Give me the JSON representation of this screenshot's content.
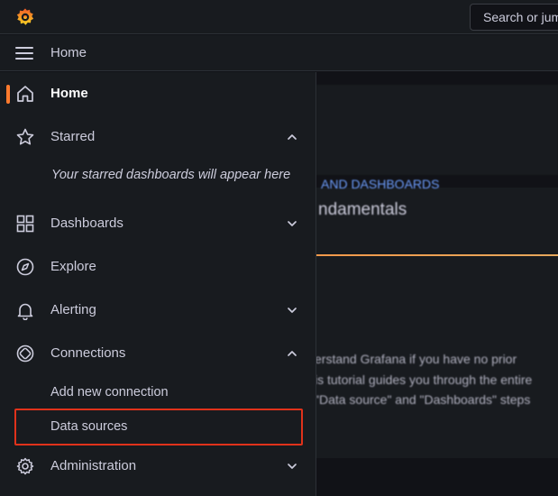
{
  "topbar": {
    "search_placeholder": "Search or jump to..."
  },
  "breadcrumb": {
    "home": "Home"
  },
  "background": {
    "kicker": "AND DASHBOARDS",
    "title": "ndamentals",
    "lines": [
      "erstand Grafana if you have no prior",
      "is tutorial guides you through the entire",
      "\"Data source\" and \"Dashboards\" steps"
    ]
  },
  "sidebar": {
    "home": "Home",
    "starred": "Starred",
    "starred_empty": "Your starred dashboards will appear here",
    "dashboards": "Dashboards",
    "explore": "Explore",
    "alerting": "Alerting",
    "connections": "Connections",
    "add_new_connection": "Add new connection",
    "data_sources": "Data sources",
    "administration": "Administration"
  },
  "colors": {
    "accent": "#ff7a2d",
    "highlight": "#e0321b"
  }
}
